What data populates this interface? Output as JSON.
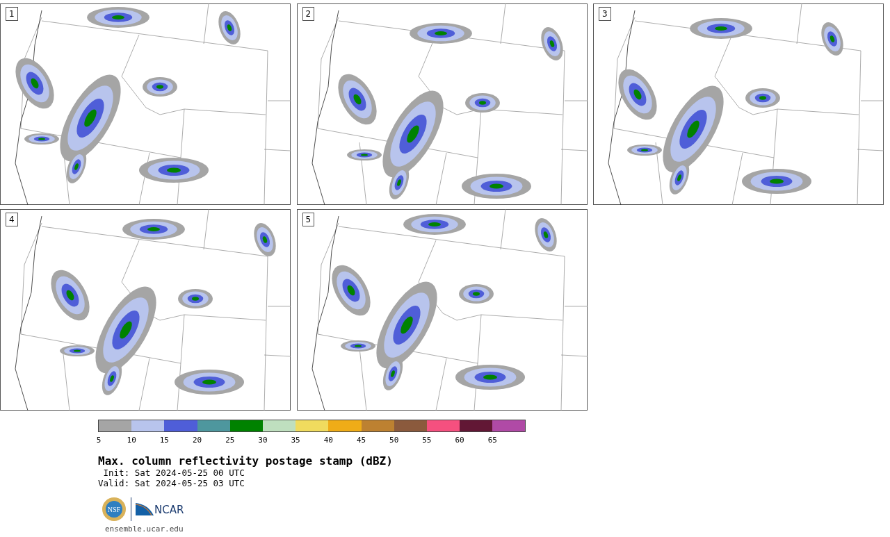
{
  "maps": [
    {
      "label": "1"
    },
    {
      "label": "2"
    },
    {
      "label": "3"
    },
    {
      "label": "4"
    },
    {
      "label": "5"
    }
  ],
  "colorbar": {
    "segments": [
      {
        "color": "#a5a5a5",
        "tick": "5"
      },
      {
        "color": "#b8c4ed",
        "tick": "10"
      },
      {
        "color": "#4f5ed8",
        "tick": "15"
      },
      {
        "color": "#4e979e",
        "tick": "20"
      },
      {
        "color": "#008200",
        "tick": "25"
      },
      {
        "color": "#bfdfbf",
        "tick": "30"
      },
      {
        "color": "#f0db5e",
        "tick": "35"
      },
      {
        "color": "#efac17",
        "tick": "40"
      },
      {
        "color": "#bd8131",
        "tick": "45"
      },
      {
        "color": "#8b5a3d",
        "tick": "50"
      },
      {
        "color": "#f5507f",
        "tick": "55"
      },
      {
        "color": "#621735",
        "tick": "60"
      },
      {
        "color": "#b04aa6",
        "tick": "65"
      }
    ]
  },
  "title": "Max. column reflectivity postage stamp (dBZ)",
  "init": " Init: Sat 2024-05-25 00 UTC",
  "valid": "Valid: Sat 2024-05-25 03 UTC",
  "logos": {
    "ncar": "NCAR",
    "nsf": "NSF"
  },
  "site": "ensemble.ucar.edu"
}
